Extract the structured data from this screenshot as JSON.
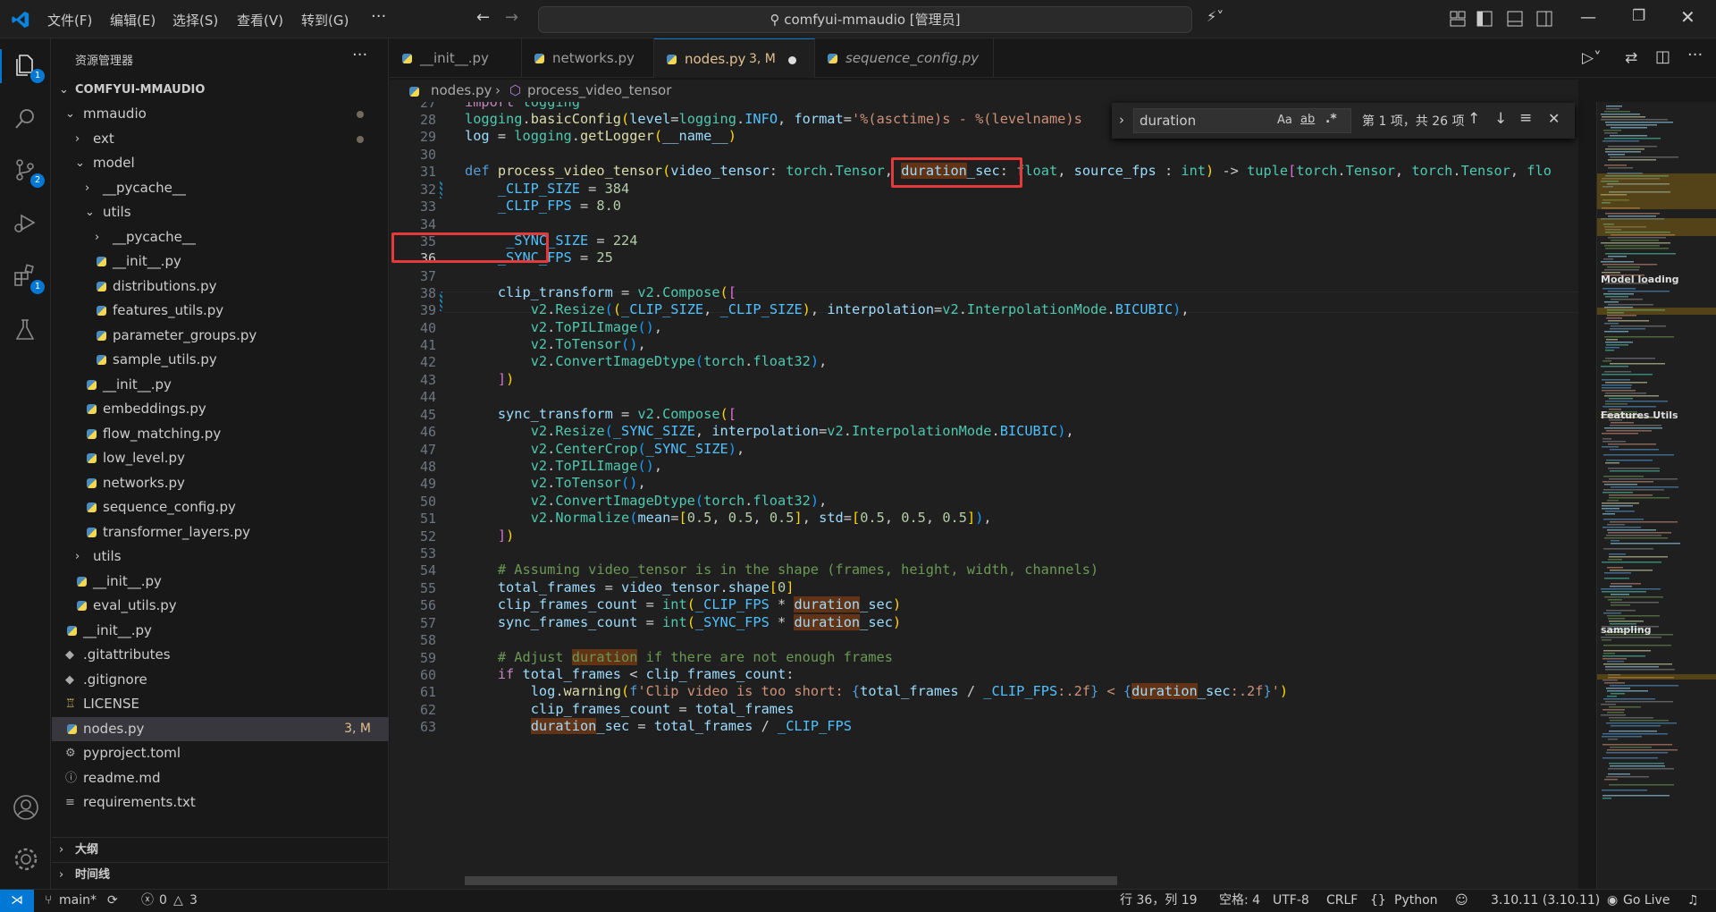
{
  "titlebar": {
    "menus": [
      "文件(F)",
      "编辑(E)",
      "选择(S)",
      "查看(V)",
      "转到(G)",
      "···"
    ],
    "command_center": "comfyui-mmaudio [管理员]"
  },
  "activity_bar": {
    "explorer_badge": "1",
    "scm_badge": "2",
    "extensions_badge": "1"
  },
  "sidebar": {
    "title": "资源管理器",
    "more": "···",
    "root": "COMFYUI-MMAUDIO",
    "tree": [
      {
        "label": "mmaudio",
        "kind": "folder-open",
        "indent": 1
      },
      {
        "label": "ext",
        "kind": "folder",
        "indent": 2
      },
      {
        "label": "model",
        "kind": "folder-open",
        "indent": 2
      },
      {
        "label": "__pycache__",
        "kind": "folder",
        "indent": 3
      },
      {
        "label": "utils",
        "kind": "folder-open",
        "indent": 3
      },
      {
        "label": "__pycache__",
        "kind": "folder",
        "indent": 4
      },
      {
        "label": "__init__.py",
        "kind": "py",
        "indent": 4
      },
      {
        "label": "distributions.py",
        "kind": "py",
        "indent": 4
      },
      {
        "label": "features_utils.py",
        "kind": "py",
        "indent": 4
      },
      {
        "label": "parameter_groups.py",
        "kind": "py",
        "indent": 4
      },
      {
        "label": "sample_utils.py",
        "kind": "py",
        "indent": 4
      },
      {
        "label": "__init__.py",
        "kind": "py",
        "indent": 3
      },
      {
        "label": "embeddings.py",
        "kind": "py",
        "indent": 3
      },
      {
        "label": "flow_matching.py",
        "kind": "py",
        "indent": 3
      },
      {
        "label": "low_level.py",
        "kind": "py",
        "indent": 3
      },
      {
        "label": "networks.py",
        "kind": "py",
        "indent": 3
      },
      {
        "label": "sequence_config.py",
        "kind": "py",
        "indent": 3
      },
      {
        "label": "transformer_layers.py",
        "kind": "py",
        "indent": 3
      },
      {
        "label": "utils",
        "kind": "folder",
        "indent": 2
      },
      {
        "label": "__init__.py",
        "kind": "py",
        "indent": 2
      },
      {
        "label": "eval_utils.py",
        "kind": "py",
        "indent": 2
      },
      {
        "label": "__init__.py",
        "kind": "py",
        "indent": 1
      },
      {
        "label": ".gitattributes",
        "kind": "git",
        "indent": 1
      },
      {
        "label": ".gitignore",
        "kind": "git",
        "indent": 1
      },
      {
        "label": "LICENSE",
        "kind": "license",
        "indent": 1
      },
      {
        "label": "nodes.py",
        "kind": "py",
        "indent": 1,
        "git": "3, M",
        "selected": true
      },
      {
        "label": "pyproject.toml",
        "kind": "gear",
        "indent": 1
      },
      {
        "label": "readme.md",
        "kind": "info",
        "indent": 1
      },
      {
        "label": "requirements.txt",
        "kind": "txt",
        "indent": 1
      }
    ],
    "outline": "大纲",
    "timeline": "时间线"
  },
  "tabs": [
    {
      "label": "__init__.py"
    },
    {
      "label": "networks.py"
    },
    {
      "label": "nodes.py",
      "badge": "3, M",
      "active": true
    },
    {
      "label": "sequence_config.py",
      "italic": true
    }
  ],
  "breadcrumbs": {
    "file": "nodes.py",
    "symbol": "process_video_tensor"
  },
  "find": {
    "query": "duration",
    "opt_case": "Aa",
    "opt_word": "ab",
    "opt_regex": ".*",
    "result": "第 1 项，共 26 项"
  },
  "editor": {
    "line_numbers": [
      "27",
      "28",
      "29",
      "30",
      "31",
      "32",
      "33",
      "34",
      "35",
      "36",
      "37",
      "38",
      "39",
      "40",
      "41",
      "42",
      "43",
      "44",
      "45",
      "46",
      "47",
      "48",
      "49",
      "50",
      "51",
      "52",
      "53",
      "54",
      "55",
      "56",
      "57",
      "58",
      "59",
      "60",
      "61",
      "62",
      "63"
    ],
    "current_line": "36"
  },
  "minimap": {
    "labels": [
      "Model loading",
      "Features Utils",
      "sampling"
    ]
  },
  "status": {
    "branch": "main*",
    "errors": "0",
    "warnings": "3",
    "position": "行 36，列 19",
    "spaces": "空格: 4",
    "encoding": "UTF-8",
    "eol": "CRLF",
    "language": "Python",
    "python_version": "3.10.11 (3.10.11)",
    "go_live": "Go Live"
  }
}
